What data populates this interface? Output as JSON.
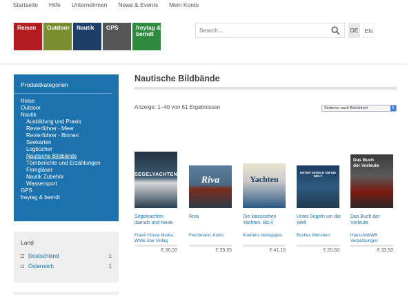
{
  "topnav": [
    "Startseite",
    "Hilfe",
    "Unternehmen",
    "News & Events",
    "Mein Konto"
  ],
  "tiles": [
    {
      "label": "Reisen",
      "color": "#b51c1f"
    },
    {
      "label": "Outdoor",
      "color": "#7a8e2f"
    },
    {
      "label": "Nautik",
      "color": "#1d3e66"
    },
    {
      "label": "GPS",
      "color": "#555555"
    },
    {
      "label": "freytag & berndt",
      "color": "#2e8b3d"
    }
  ],
  "search": {
    "placeholder": "Search..."
  },
  "lang": {
    "de": "DE",
    "en": "EN"
  },
  "categories": {
    "heading": "Produktkategorien",
    "items": [
      {
        "label": "Reise",
        "level": 0
      },
      {
        "label": "Outdoor",
        "level": 0
      },
      {
        "label": "Nautik",
        "level": 0
      },
      {
        "label": "Ausbildung und Praxis",
        "level": 1
      },
      {
        "label": "Revierführer - Meer",
        "level": 1
      },
      {
        "label": "Revierführer - Binnen",
        "level": 1
      },
      {
        "label": "Seekarten",
        "level": 1
      },
      {
        "label": "Logbücher",
        "level": 1
      },
      {
        "label": "Nautische Bildbände",
        "level": 1,
        "active": true
      },
      {
        "label": "Törnberichte und Erzählungen",
        "level": 1
      },
      {
        "label": "Ferngläser",
        "level": 1
      },
      {
        "label": "Nautik Zubehör",
        "level": 1
      },
      {
        "label": "Wassersport",
        "level": 1
      },
      {
        "label": "GPS",
        "level": 0
      },
      {
        "label": "freytag & berndt",
        "level": 0
      }
    ]
  },
  "land": {
    "heading": "Land",
    "items": [
      {
        "label": "Deutschland",
        "count": "1"
      },
      {
        "label": "Österreich",
        "count": "1"
      }
    ]
  },
  "main": {
    "title": "Nautische Bildbände",
    "result_count": "Anzeige: 1–40 von 61 Ergebnissen",
    "sort_label": "Sortieren nach Beliebtheit"
  },
  "products": [
    {
      "title": "Segelyachten damals und heute",
      "publisher": "Travel House Media, White Star Verlag",
      "price": "€ 36,00",
      "cover_text": "SEGELYACHTEN"
    },
    {
      "title": "Riva",
      "publisher": "Frechmann, Kolon",
      "price": "€ 39,95",
      "cover_text": "Riva"
    },
    {
      "title": "Die klassischen Yachten. Bd.4",
      "publisher": "Koehlers Verlagsges.",
      "price": "€ 41,10",
      "cover_text": "Yachten"
    },
    {
      "title": "Unter Segeln um die Welt",
      "publisher": "Bucher, München",
      "price": "€ 20,60",
      "cover_text": "UNTER SEGELN UM DIE WELT"
    },
    {
      "title": "Das Buch der Vorleute",
      "publisher": "Hauschild/WB Verpackungen",
      "price": "€ 33,50",
      "cover_text": "Das Buch der Vorleute"
    }
  ]
}
